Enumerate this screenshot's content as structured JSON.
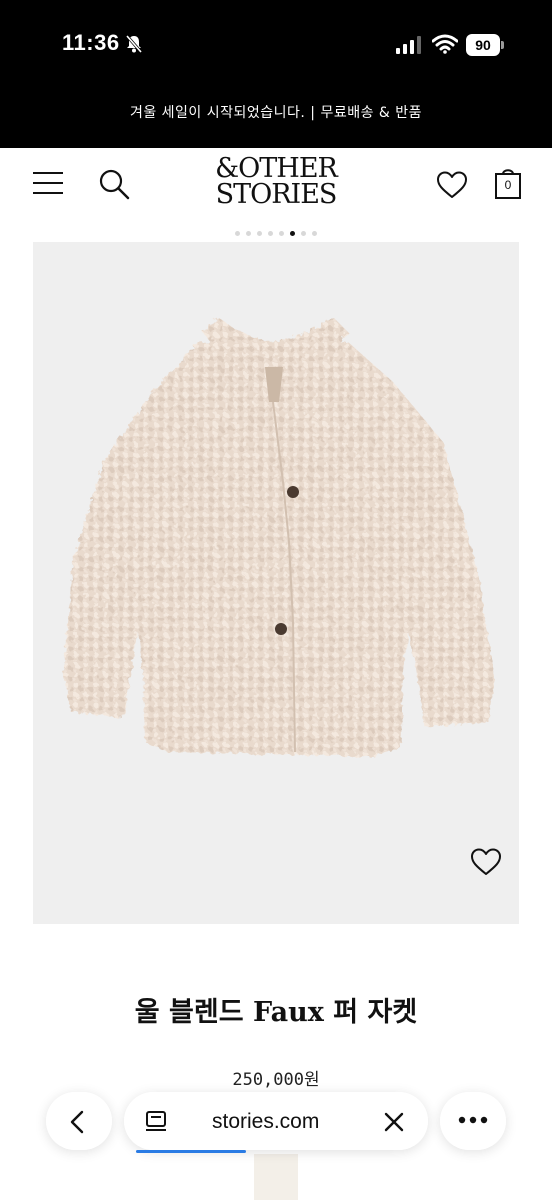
{
  "status_bar": {
    "time": "11:36",
    "battery": "90",
    "icons": [
      "bell-slash-icon",
      "cellular-signal-icon",
      "wifi-icon",
      "battery-icon"
    ]
  },
  "announcement": {
    "text": "겨울 세일이 시작되었습니다. | 무료배송 & 반품"
  },
  "header": {
    "logo_line1": "&OTHER",
    "logo_line2": "STORIES",
    "bag_count": "0",
    "icons": [
      "menu-icon",
      "search-icon",
      "heart-icon",
      "shopping-bag-icon"
    ]
  },
  "carousel": {
    "total": 8,
    "active_index": 5
  },
  "product": {
    "title": "울 블렌드 Faux 퍼 자켓",
    "price": "250,000원",
    "image_description_icon": "wishlist-heart-icon"
  },
  "browser": {
    "url": "stories.com",
    "icons": [
      "chevron-left-icon",
      "reader-icon",
      "close-icon",
      "more-icon"
    ],
    "accent": "#2a7be4"
  },
  "colors": {
    "background": "#ffffff",
    "bars": "#000000",
    "image_bg": "#efefef",
    "jacket": "#e8d9cc"
  }
}
